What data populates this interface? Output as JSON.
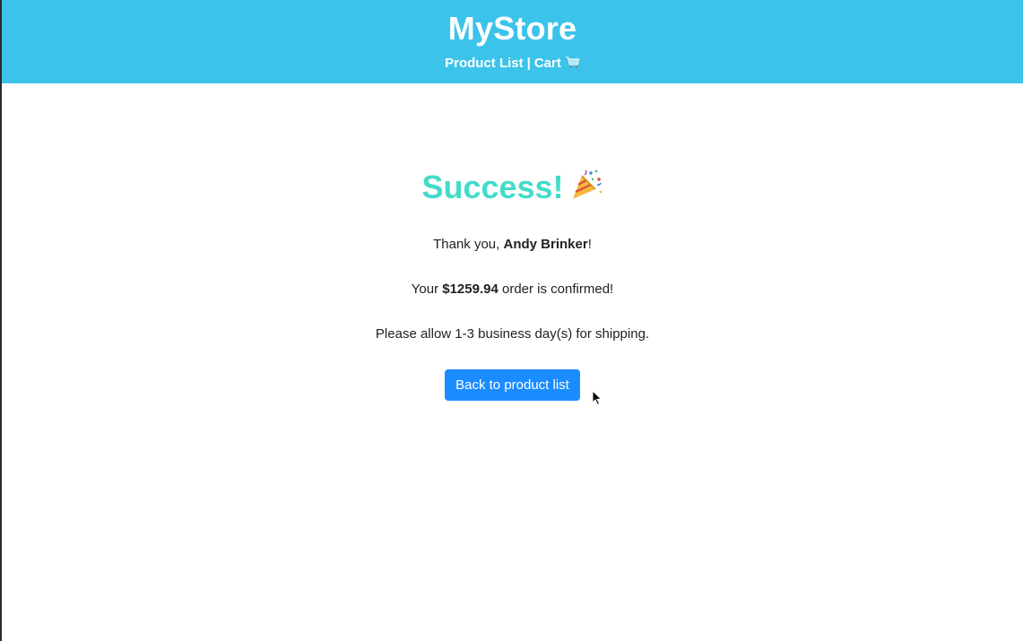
{
  "header": {
    "brand": "MyStore",
    "nav": {
      "product_list": "Product List",
      "separator": "|",
      "cart": "Cart",
      "cart_icon": "shopping-cart-icon"
    },
    "background_color": "#3bc3ea"
  },
  "confirmation": {
    "title": "Success!",
    "title_icon": "party-popper-icon",
    "title_color": "#43dcc9",
    "thanks_prefix": "Thank you, ",
    "customer_name": "Andy Brinker",
    "thanks_suffix": "!",
    "order_prefix": "Your ",
    "order_total": "$1259.94",
    "order_suffix": " order is confirmed!",
    "shipping_note": "Please allow 1-3 business day(s) for shipping.",
    "back_button_label": "Back to product list",
    "button_color": "#1a8cff"
  }
}
